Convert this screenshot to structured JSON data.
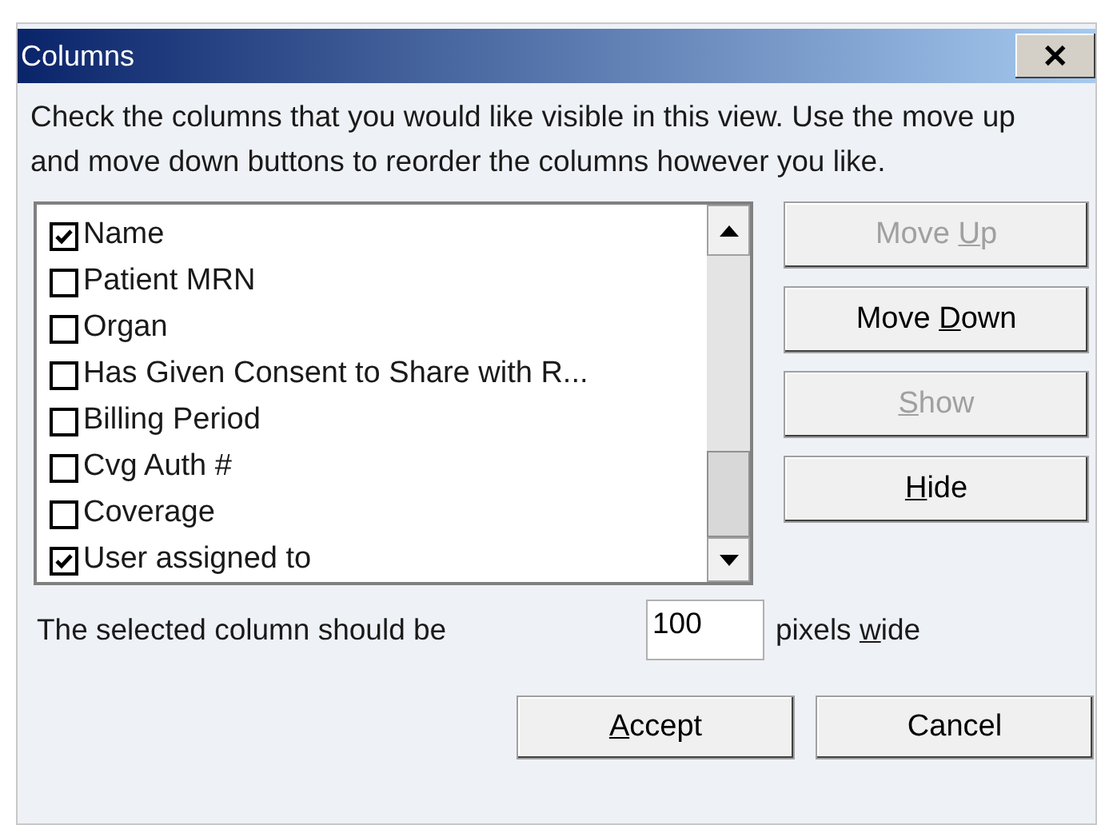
{
  "window": {
    "title": "Columns",
    "close": "✕"
  },
  "instructions": "Check the columns that you would like visible in this view. Use the move up and move down buttons to reorder the columns however you like.",
  "columns": [
    {
      "label": "Name",
      "checked": true
    },
    {
      "label": "Patient MRN",
      "checked": false
    },
    {
      "label": "Organ",
      "checked": false
    },
    {
      "label": "Has Given Consent to Share with R...",
      "checked": false
    },
    {
      "label": "Billing Period",
      "checked": false
    },
    {
      "label": "Cvg Auth #",
      "checked": false
    },
    {
      "label": "Coverage",
      "checked": false
    },
    {
      "label": "User assigned to",
      "checked": true
    }
  ],
  "side_buttons": [
    {
      "before": "Move ",
      "key": "U",
      "after": "p",
      "disabled": true
    },
    {
      "before": "Move ",
      "key": "D",
      "after": "own",
      "disabled": false
    },
    {
      "key": "S",
      "after": "how",
      "disabled": true
    },
    {
      "key": "H",
      "after": "ide",
      "disabled": false
    }
  ],
  "width_row": {
    "label": "The selected column should be",
    "value": "100",
    "suffix_before": "pixels ",
    "suffix_key": "w",
    "suffix_after": "ide"
  },
  "footer_buttons": [
    {
      "key": "A",
      "after": "ccept",
      "disabled": false
    },
    {
      "before": "Cancel",
      "disabled": false
    }
  ]
}
